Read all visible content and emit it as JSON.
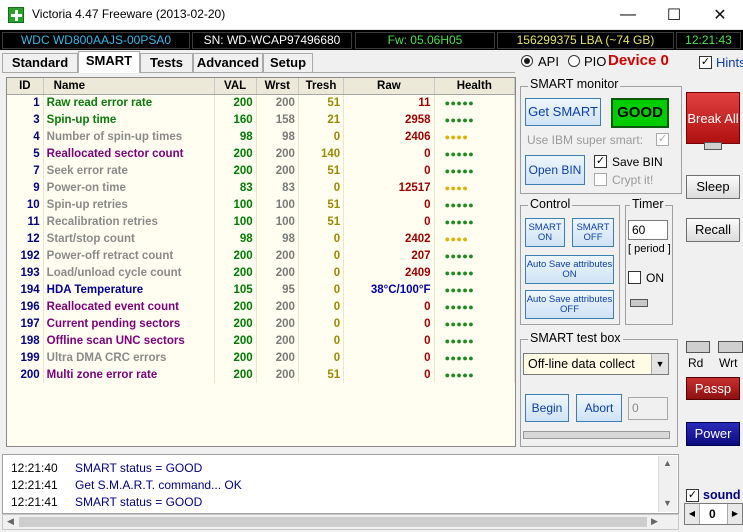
{
  "window": {
    "title": "Victoria 4.47  Freeware (2013-02-20)",
    "min": "—",
    "max": "☐",
    "close": "✕"
  },
  "info": {
    "model": "WDC WD800AAJS-00PSA0",
    "serial": "SN: WD-WCAP97496680",
    "firmware": "Fw: 05.06H05",
    "lba": "156299375 LBA (~74 GB)",
    "time": "12:21:43"
  },
  "tabs": [
    "Standard",
    "SMART",
    "Tests",
    "Advanced",
    "Setup"
  ],
  "mode": {
    "api": "API",
    "pio": "PIO",
    "device": "Device 0",
    "hints": "Hints"
  },
  "table": {
    "headers": [
      "ID",
      "Name",
      "VAL",
      "Wrst",
      "Tresh",
      "Raw",
      "Health"
    ],
    "rows": [
      {
        "id": "1",
        "name": "Raw read error rate",
        "val": "200",
        "wrst": "200",
        "tresh": "51",
        "raw": "11",
        "health": "●●●●●",
        "nc": "#0a7a0a",
        "hc": "#1f8a1f"
      },
      {
        "id": "3",
        "name": "Spin-up time",
        "val": "160",
        "wrst": "158",
        "tresh": "21",
        "raw": "2958",
        "health": "●●●●●",
        "nc": "#0a7a0a",
        "hc": "#1f8a1f"
      },
      {
        "id": "4",
        "name": "Number of spin-up times",
        "val": "98",
        "wrst": "98",
        "tresh": "0",
        "raw": "2406",
        "health": "●●●●",
        "nc": "#8a8a8a",
        "hc": "#e0b000"
      },
      {
        "id": "5",
        "name": "Reallocated sector count",
        "val": "200",
        "wrst": "200",
        "tresh": "140",
        "raw": "0",
        "health": "●●●●●",
        "nc": "#7a007a",
        "hc": "#1f8a1f"
      },
      {
        "id": "7",
        "name": "Seek error rate",
        "val": "200",
        "wrst": "200",
        "tresh": "51",
        "raw": "0",
        "health": "●●●●●",
        "nc": "#8a8a8a",
        "hc": "#1f8a1f"
      },
      {
        "id": "9",
        "name": "Power-on time",
        "val": "83",
        "wrst": "83",
        "tresh": "0",
        "raw": "12517",
        "health": "●●●●",
        "nc": "#8a8a8a",
        "hc": "#e0b000"
      },
      {
        "id": "10",
        "name": "Spin-up retries",
        "val": "100",
        "wrst": "100",
        "tresh": "51",
        "raw": "0",
        "health": "●●●●●",
        "nc": "#8a8a8a",
        "hc": "#1f8a1f"
      },
      {
        "id": "11",
        "name": "Recalibration retries",
        "val": "100",
        "wrst": "100",
        "tresh": "51",
        "raw": "0",
        "health": "●●●●●",
        "nc": "#8a8a8a",
        "hc": "#1f8a1f"
      },
      {
        "id": "12",
        "name": "Start/stop count",
        "val": "98",
        "wrst": "98",
        "tresh": "0",
        "raw": "2402",
        "health": "●●●●",
        "nc": "#8a8a8a",
        "hc": "#e0b000"
      },
      {
        "id": "192",
        "name": "Power-off retract count",
        "val": "200",
        "wrst": "200",
        "tresh": "0",
        "raw": "207",
        "health": "●●●●●",
        "nc": "#8a8a8a",
        "hc": "#1f8a1f"
      },
      {
        "id": "193",
        "name": "Load/unload cycle count",
        "val": "200",
        "wrst": "200",
        "tresh": "0",
        "raw": "2409",
        "health": "●●●●●",
        "nc": "#8a8a8a",
        "hc": "#1f8a1f"
      },
      {
        "id": "194",
        "name": "HDA Temperature",
        "val": "105",
        "wrst": "95",
        "tresh": "0",
        "raw": "38°C/100°F",
        "health": "●●●●●",
        "nc": "#000099",
        "hc": "#1f8a1f"
      },
      {
        "id": "196",
        "name": "Reallocated event count",
        "val": "200",
        "wrst": "200",
        "tresh": "0",
        "raw": "0",
        "health": "●●●●●",
        "nc": "#7a007a",
        "hc": "#1f8a1f"
      },
      {
        "id": "197",
        "name": "Current pending sectors",
        "val": "200",
        "wrst": "200",
        "tresh": "0",
        "raw": "0",
        "health": "●●●●●",
        "nc": "#7a007a",
        "hc": "#1f8a1f"
      },
      {
        "id": "198",
        "name": "Offline scan UNC sectors",
        "val": "200",
        "wrst": "200",
        "tresh": "0",
        "raw": "0",
        "health": "●●●●●",
        "nc": "#7a007a",
        "hc": "#1f8a1f"
      },
      {
        "id": "199",
        "name": "Ultra DMA CRC errors",
        "val": "200",
        "wrst": "200",
        "tresh": "0",
        "raw": "0",
        "health": "●●●●●",
        "nc": "#8a8a8a",
        "hc": "#1f8a1f"
      },
      {
        "id": "200",
        "name": "Multi zone error rate",
        "val": "200",
        "wrst": "200",
        "tresh": "51",
        "raw": "0",
        "health": "●●●●●",
        "nc": "#7a007a",
        "hc": "#1f8a1f"
      }
    ]
  },
  "smart_monitor": {
    "title": "SMART monitor",
    "get_smart": "Get SMART",
    "status": "GOOD",
    "ibm_option": "Use IBM super smart:",
    "open_bin": "Open BIN",
    "save_bin": "Save BIN",
    "crypt": "Crypt it!"
  },
  "control": {
    "title": "Control",
    "smart_on": "SMART ON",
    "smart_off": "SMART OFF",
    "auto_save_on": "Auto Save attributes ON",
    "auto_save_off": "Auto Save attributes OFF"
  },
  "timer": {
    "title": "Timer",
    "value": "60",
    "period": "[ period ]",
    "on": "ON"
  },
  "test_box": {
    "title": "SMART test box",
    "selected": "Off-line data collect",
    "begin": "Begin",
    "abort": "Abort",
    "value": "0"
  },
  "right": {
    "break_all": "Break All",
    "sleep": "Sleep",
    "recall": "Recall",
    "rd": "Rd",
    "wrt": "Wrt",
    "passp": "Passp",
    "power": "Power",
    "sound": "sound",
    "sound_value": "0"
  },
  "log": [
    {
      "time": "12:21:40",
      "msg": "SMART status = GOOD"
    },
    {
      "time": "12:21:41",
      "msg": "Get S.M.A.R.T. command... OK"
    },
    {
      "time": "12:21:41",
      "msg": "SMART status = GOOD"
    }
  ],
  "colors": {
    "good": "#00cc00",
    "device": "#d40000",
    "break": "#cc1a1a",
    "passp": "#b01c1c",
    "power": "#1414a0"
  }
}
